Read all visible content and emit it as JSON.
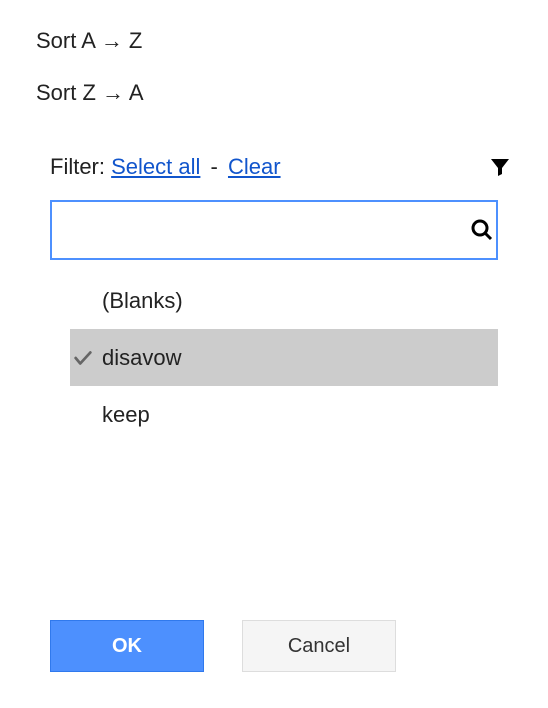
{
  "sort": {
    "az": "Sort A → Z",
    "za": "Sort Z → A"
  },
  "filter": {
    "label": "Filter:",
    "select_all": "Select all",
    "separator": "-",
    "clear": "Clear",
    "search_value": "",
    "items": [
      {
        "label": "(Blanks)",
        "checked": false,
        "highlighted": false
      },
      {
        "label": "disavow",
        "checked": true,
        "highlighted": true
      },
      {
        "label": "keep",
        "checked": false,
        "highlighted": false
      }
    ]
  },
  "buttons": {
    "ok": "OK",
    "cancel": "Cancel"
  }
}
